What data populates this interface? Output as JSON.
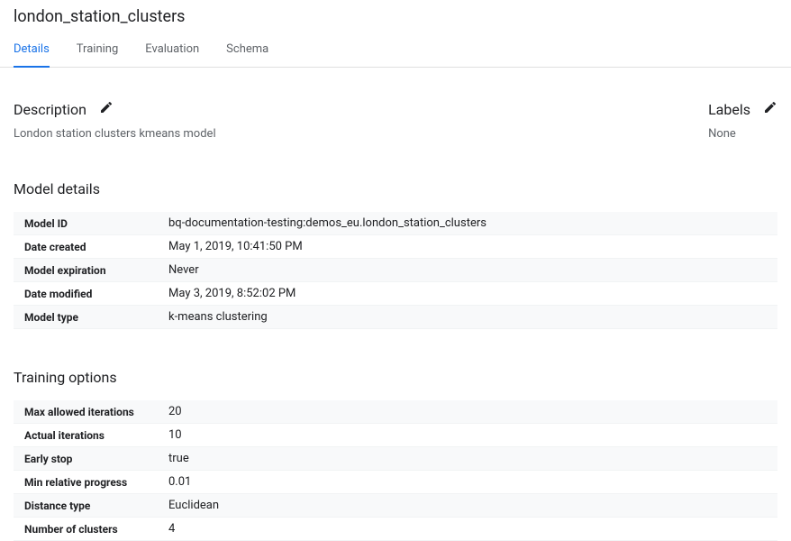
{
  "title": "london_station_clusters",
  "tabs": [
    "Details",
    "Training",
    "Evaluation",
    "Schema"
  ],
  "description": {
    "label": "Description",
    "value": "London station clusters kmeans model"
  },
  "labels": {
    "label": "Labels",
    "value": "None"
  },
  "sections": {
    "model_details": {
      "title": "Model details",
      "rows": [
        {
          "key": "Model ID",
          "val": "bq-documentation-testing:demos_eu.london_station_clusters"
        },
        {
          "key": "Date created",
          "val": "May 1, 2019, 10:41:50 PM"
        },
        {
          "key": "Model expiration",
          "val": "Never"
        },
        {
          "key": "Date modified",
          "val": "May 3, 2019, 8:52:02 PM"
        },
        {
          "key": "Model type",
          "val": "k-means clustering"
        }
      ]
    },
    "training_options": {
      "title": "Training options",
      "rows": [
        {
          "key": "Max allowed iterations",
          "val": "20"
        },
        {
          "key": "Actual iterations",
          "val": "10"
        },
        {
          "key": "Early stop",
          "val": "true"
        },
        {
          "key": "Min relative progress",
          "val": "0.01"
        },
        {
          "key": "Distance type",
          "val": "Euclidean"
        },
        {
          "key": "Number of clusters",
          "val": "4"
        }
      ]
    }
  }
}
